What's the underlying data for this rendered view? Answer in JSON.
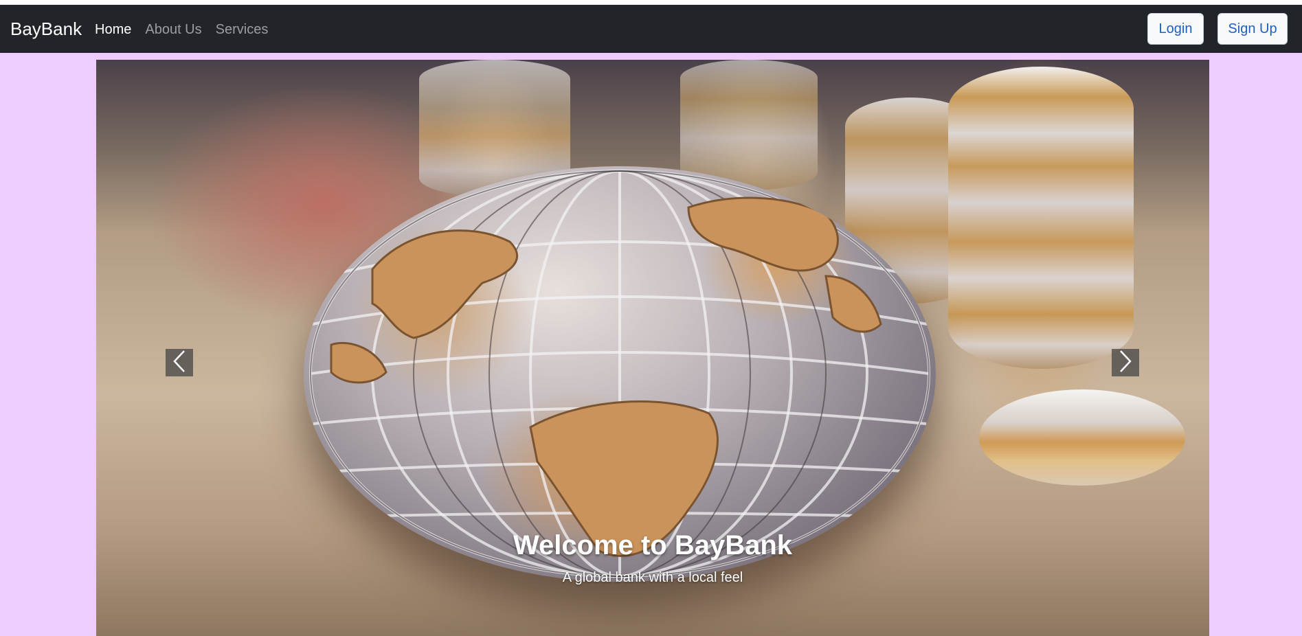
{
  "navbar": {
    "brand": "BayBank",
    "links": [
      {
        "label": "Home",
        "active": true
      },
      {
        "label": "About Us",
        "active": false
      },
      {
        "label": "Services",
        "active": false
      }
    ],
    "login_label": "Login",
    "signup_label": "Sign Up"
  },
  "carousel": {
    "caption_title": "Welcome to BayBank",
    "caption_subtitle": "A global bank with a local feel",
    "prev_icon": "chevron-left-icon",
    "next_icon": "chevron-right-icon"
  },
  "colors": {
    "page_background": "#efccff",
    "navbar_background": "#212529",
    "button_text": "#1f5fbf"
  }
}
